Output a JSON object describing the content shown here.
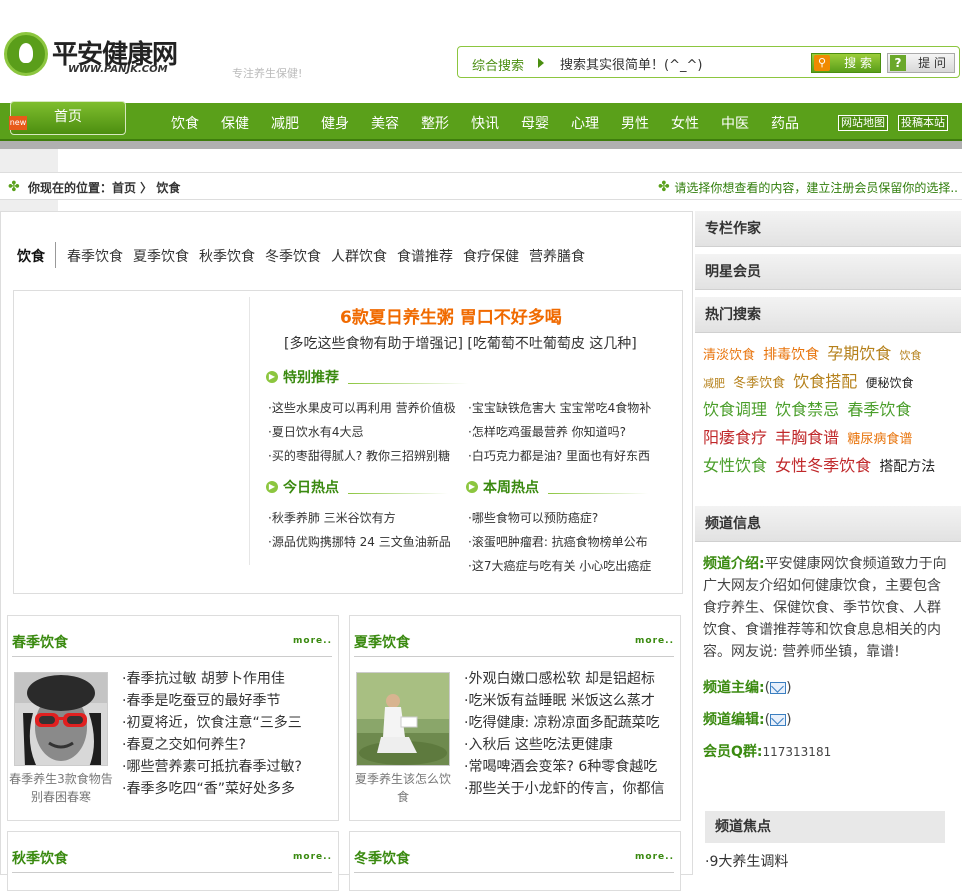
{
  "header": {
    "logo_text": "平安健康网",
    "logo_url": "WWW.PANJK.COM",
    "slogan": "专注养生保健!",
    "search": {
      "label": "综合搜索",
      "placeholder": "搜索其实很简单！(^_^)",
      "search_btn": "搜 索",
      "help_btn": "提 问"
    }
  },
  "nav": {
    "home": "首页",
    "home_tag": "new",
    "items": [
      "饮食",
      "保健",
      "减肥",
      "健身",
      "美容",
      "整形",
      "快讯",
      "母婴",
      "心理",
      "男性",
      "女性",
      "中医",
      "药品"
    ],
    "right": [
      "网站地图",
      "投稿本站"
    ]
  },
  "breadcrumb": {
    "text": "你现在的位置：首页 〉 饮食",
    "right": "请选择你想查看的内容，建立注册会员保留你的选择.."
  },
  "subnav": {
    "active": "饮食",
    "items": [
      "春季饮食",
      "夏季饮食",
      "秋季饮食",
      "冬季饮食",
      "人群饮食",
      "食谱推荐",
      "食疗保健",
      "营养膳食"
    ]
  },
  "feature": {
    "headline": "6款夏日养生粥  胃口不好多喝",
    "subhead": "[多吃这些食物有助于增强记] [吃葡萄不吐葡萄皮 这几种]",
    "special_title": "特别推荐",
    "special_links": [
      "·这些水果皮可以再利用 营养价值极",
      "·宝宝缺铁危害大 宝宝常吃4食物补",
      "·夏日饮水有4大忌",
      "·怎样吃鸡蛋最营养 你知道吗?",
      "·买的枣甜得腻人? 教你三招辨别糖",
      "·白巧克力都是油? 里面也有好东西"
    ],
    "today_title": "今日热点",
    "today_links": [
      "·秋季养肺 三米谷饮有方",
      "·源品优购携挪特 24 三文鱼油新品"
    ],
    "week_title": "本周热点",
    "week_links": [
      "·哪些食物可以预防癌症?",
      "·滚蛋吧肿瘤君: 抗癌食物榜单公布",
      "·这7大癌症与吃有关 小心吃出癌症"
    ]
  },
  "boxes": [
    {
      "title": "春季饮食",
      "more": "more..",
      "caption": "春季养生3款食物告别春困春寒",
      "items": [
        "·春季抗过敏 胡萝卜作用佳",
        "·春季是吃蚕豆的最好季节",
        "·初夏将近，饮食注意“三多三",
        "·春夏之交如何养生?",
        "·哪些营养素可抵抗春季过敏?",
        "·春季多吃四“香”菜好处多多"
      ]
    },
    {
      "title": "夏季饮食",
      "more": "more..",
      "caption": "夏季养生该怎么饮食",
      "items": [
        "·外观白嫩口感松软 却是铝超标",
        "·吃米饭有益睡眠 米饭这么蒸才",
        "·吃得健康: 凉粉凉面多配蔬菜吃",
        "·入秋后 这些吃法更健康",
        "·常喝啤酒会变笨? 6种零食越吃",
        "·那些关于小龙虾的传言，你都信"
      ]
    },
    {
      "title": "秋季饮食",
      "more": "more.."
    },
    {
      "title": "冬季饮食",
      "more": "more.."
    }
  ],
  "sidebar": {
    "experts": "专栏作家",
    "members": "明星会员",
    "hot_search": "热门搜索",
    "tags": [
      {
        "text": "清淡饮食",
        "color": "#e8740c",
        "size": 13
      },
      {
        "text": "排毒饮食",
        "color": "#e8740c",
        "size": 14
      },
      {
        "text": "孕期饮食",
        "color": "#b5801a",
        "size": 16
      },
      {
        "text": "饮食",
        "color": "#b5801a",
        "size": 11
      },
      {
        "text": "减肥",
        "color": "#b5801a",
        "size": 11
      },
      {
        "text": "冬季饮食",
        "color": "#b5801a",
        "size": 13
      },
      {
        "text": "饮食搭配",
        "color": "#b5801a",
        "size": 16
      },
      {
        "text": "便秘饮食",
        "color": "#222",
        "size": 12
      },
      {
        "text": "饮食调理",
        "color": "#4a9e2a",
        "size": 16
      },
      {
        "text": "饮食禁忌",
        "color": "#4a9e2a",
        "size": 16
      },
      {
        "text": "春季饮食",
        "color": "#4a9e2a",
        "size": 16
      },
      {
        "text": "阳痿食疗",
        "color": "#c0282a",
        "size": 16
      },
      {
        "text": "丰胸食谱",
        "color": "#c0282a",
        "size": 16
      },
      {
        "text": "糖尿病食谱",
        "color": "#e8740c",
        "size": 13
      },
      {
        "text": "女性饮食",
        "color": "#4a9e2a",
        "size": 16
      },
      {
        "text": "女性冬季饮食",
        "color": "#c0282a",
        "size": 16
      },
      {
        "text": "搭配方法",
        "color": "#222",
        "size": 14
      }
    ],
    "channel_head": "频道信息",
    "intro_label": "频道介绍:",
    "intro_text": "平安健康网饮食频道致力于向广大网友介绍如何健康饮食，主要包含食疗养生、保健饮食、季节饮食、人群饮食、食谱推荐等和饮食息息相关的内容。网友说: 营养师坐镇，靠谱!",
    "editor_label": "频道主编:",
    "editor2_label": "频道编辑:",
    "qq_label": "会员Q群:",
    "qq_value": "117313181",
    "focus_head": "频道焦点",
    "focus_item": "·9大养生调料"
  }
}
